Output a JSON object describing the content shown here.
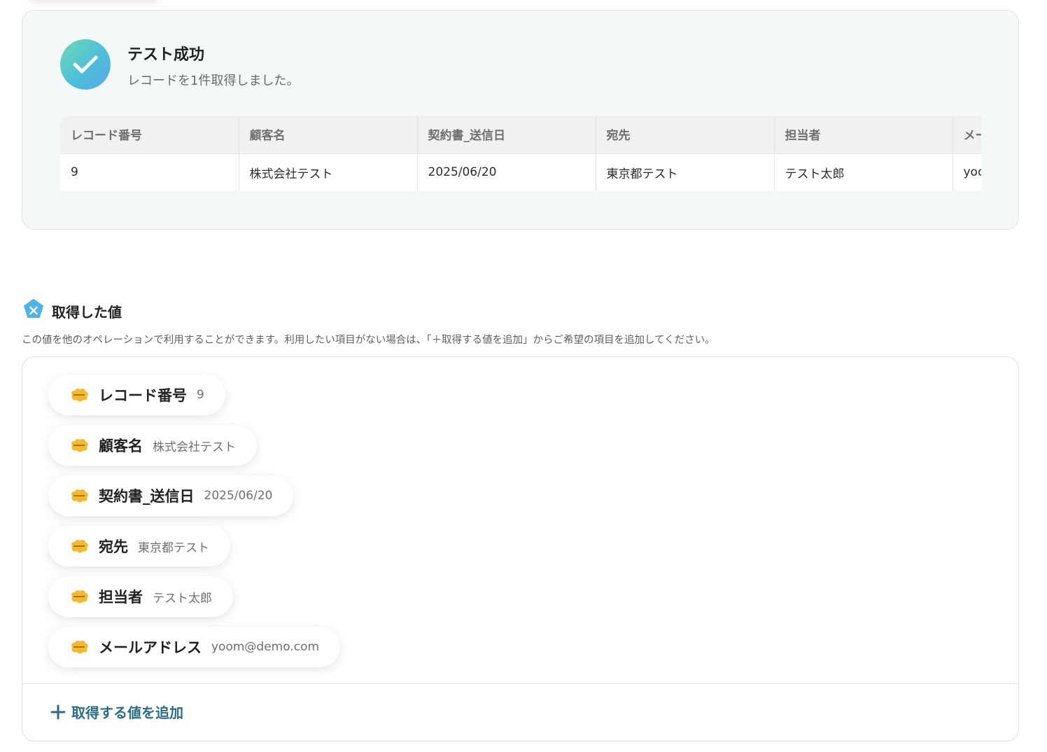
{
  "result": {
    "title": "テスト成功",
    "subtitle": "レコードを1件取得しました。",
    "table": {
      "headers": [
        "レコード番号",
        "顧客名",
        "契約書_送信日",
        "宛先",
        "担当者",
        "メールアドレス"
      ],
      "row": [
        "9",
        "株式会社テスト",
        "2025/06/20",
        "東京都テスト",
        "テスト太郎",
        "yoom@demo.com"
      ]
    }
  },
  "acquired": {
    "title": "取得した値",
    "description": "この値を他のオペレーションで利用することができます。利用したい項目がない場合は、「＋取得する値を追加」からご希望の項目を追加してください。",
    "items": [
      {
        "label": "レコード番号",
        "value": "9"
      },
      {
        "label": "顧客名",
        "value": "株式会社テスト"
      },
      {
        "label": "契約書_送信日",
        "value": "2025/06/20"
      },
      {
        "label": "宛先",
        "value": "東京都テスト"
      },
      {
        "label": "担当者",
        "value": "テスト太郎"
      },
      {
        "label": "メールアドレス",
        "value": "yoom@demo.com"
      }
    ],
    "add_label": "取得する値を追加"
  },
  "colors": {
    "accent": "#2e6b84",
    "kintone": "#f5b82e",
    "success_gradient_start": "#6fd9b1",
    "success_gradient_end": "#5aa7ea"
  },
  "icons": {
    "success": "check-icon",
    "section": "variable-icon",
    "item": "kintone-icon",
    "add": "plus-icon"
  }
}
